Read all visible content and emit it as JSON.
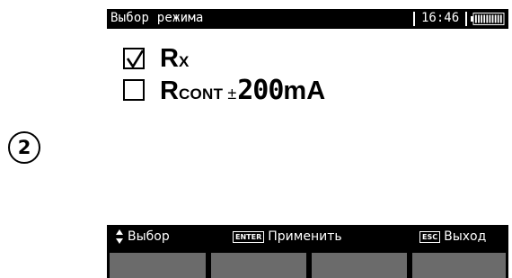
{
  "step": {
    "number": "2"
  },
  "header": {
    "title": "Выбор режима",
    "time": "16:46",
    "battery_icon": "battery-full-icon",
    "battery_level": 1.0
  },
  "options": [
    {
      "main": "R",
      "sub": "X",
      "checked": true
    },
    {
      "main": "R",
      "sub": "CONT",
      "plusminus": "±",
      "value": "200",
      "unit": "mA",
      "checked": false
    }
  ],
  "hints": {
    "select": {
      "icon": "up-down-arrows-icon",
      "label": "Выбор"
    },
    "apply": {
      "key": "ENTER",
      "label": "Применить"
    },
    "exit": {
      "key": "ESC",
      "label": "Выход"
    }
  },
  "softkeys": [
    "",
    "",
    "",
    ""
  ],
  "colors": {
    "bar": "#000000",
    "softkey": "#6b6b6b",
    "text": "#000000"
  }
}
